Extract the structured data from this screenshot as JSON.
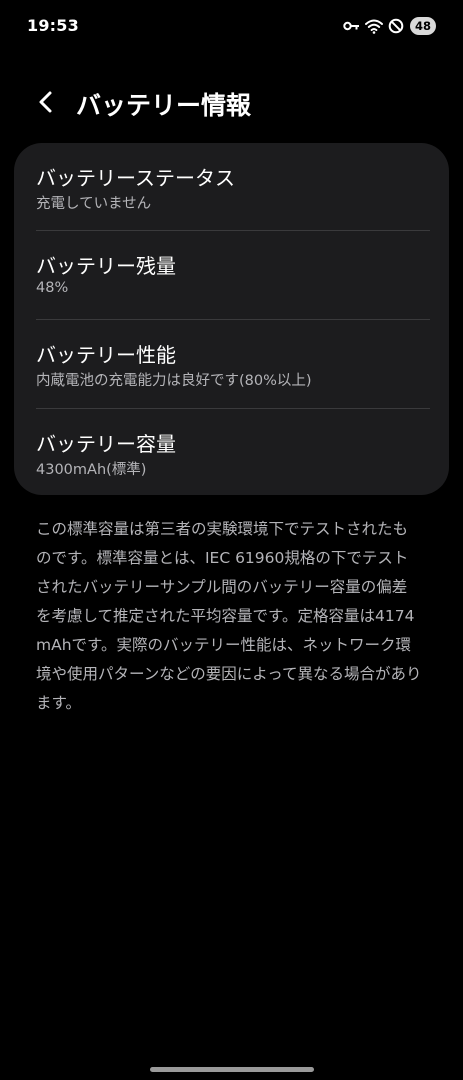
{
  "status_bar": {
    "time": "19:53",
    "battery_level": "48",
    "icons": [
      "key-icon",
      "wifi-icon",
      "do-not-disturb-icon",
      "battery-icon"
    ]
  },
  "header": {
    "back_icon": "chevron-left-icon",
    "title": "バッテリー情報"
  },
  "rows": [
    {
      "title": "バッテリーステータス",
      "value": "充電していません"
    },
    {
      "title": "バッテリー残量",
      "value": "48%"
    },
    {
      "title": "バッテリー性能",
      "value": "内蔵電池の充電能力は良好です(80%以上)"
    },
    {
      "title": "バッテリー容量",
      "value": "4300mAh(標準)"
    }
  ],
  "footnote": "この標準容量は第三者の実験環境下でテストされたものです。標準容量とは、IEC 61960規格の下でテストされたバッテリーサンプル間のバッテリー容量の偏差を考慮して推定された平均容量です。定格容量は4174mAhです。実際のバッテリー性能は、ネットワーク環境や使用パターンなどの要因によって異なる場合があります。",
  "colors": {
    "background": "#000000",
    "card": "#1c1c1e",
    "primary_text": "#ffffff",
    "secondary_text": "#b4b4b8"
  }
}
